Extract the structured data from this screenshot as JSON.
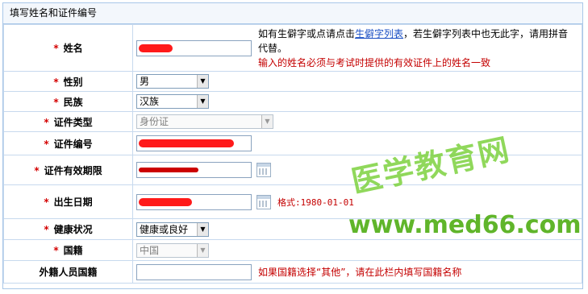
{
  "section_title": "填写姓名和证件编号",
  "required_mark": "*",
  "fields": {
    "name": {
      "label": "姓名",
      "hint_prefix": "如有生僻字或点请点击",
      "hint_link": "生僻字列表",
      "hint_suffix": "，若生僻字列表中也无此字，请用拼音代替。",
      "hint_warning": "输入的姓名必须与考试时提供的有效证件上的姓名一致"
    },
    "gender": {
      "label": "性别",
      "value": "男"
    },
    "ethnicity": {
      "label": "民族",
      "value": "汉族"
    },
    "id_type": {
      "label": "证件类型",
      "value": "身份证"
    },
    "id_number": {
      "label": "证件编号"
    },
    "id_validity": {
      "label": "证件有效期限"
    },
    "birth_date": {
      "label": "出生日期",
      "format_hint": "格式:1980-01-01"
    },
    "health": {
      "label": "健康状况",
      "value": "健康或良好"
    },
    "nationality": {
      "label": "国籍",
      "value": "中国"
    },
    "foreign_nationality": {
      "label": "外籍人员国籍",
      "hint": "如果国籍选择“其他”，请在此栏内填写国籍名称"
    }
  },
  "watermark": {
    "cn": "医学教育网",
    "url": "www.med66.com"
  },
  "colors": {
    "required": "#d40000",
    "link": "#1a4fc4",
    "watermark": "#7dd23f"
  }
}
